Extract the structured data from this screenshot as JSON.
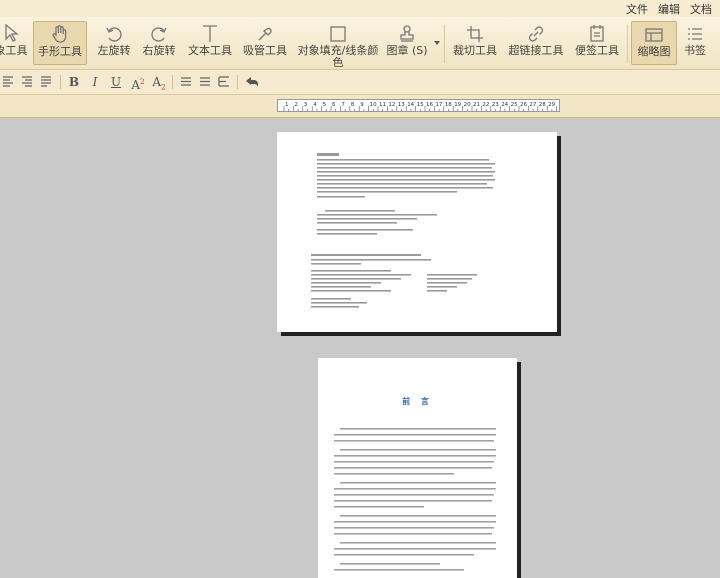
{
  "menu": {
    "items": [
      "文件",
      "编辑",
      "文档"
    ]
  },
  "toolbar": {
    "tools": [
      {
        "label": "象工具",
        "icon": "select-arrow-icon"
      },
      {
        "label": "手形工具",
        "icon": "hand-icon"
      },
      {
        "label": "左旋转",
        "icon": "rotate-left-icon"
      },
      {
        "label": "右旋转",
        "icon": "rotate-right-icon"
      },
      {
        "label": "文本工具",
        "icon": "text-t-icon"
      },
      {
        "label": "吸管工具",
        "icon": "eyedropper-icon"
      },
      {
        "label": "对象填充/线条颜色",
        "icon": "fill-box-icon"
      },
      {
        "label": "图章 (S)",
        "icon": "stamp-icon"
      },
      {
        "label": "裁切工具",
        "icon": "crop-icon"
      },
      {
        "label": "超链接工具",
        "icon": "link-icon"
      },
      {
        "label": "便签工具",
        "icon": "note-icon"
      },
      {
        "label": "缩略图",
        "icon": "thumbnail-icon"
      },
      {
        "label": "书签",
        "icon": "bookmark-list-icon"
      }
    ],
    "active": "手形工具"
  },
  "format_bar": {
    "bold": "B",
    "italic": "I",
    "underline": "U",
    "superscript": "A",
    "superscript_mark": "2",
    "subscript": "A",
    "subscript_mark": "2"
  },
  "ruler": {
    "ticks": [
      "1",
      "2",
      "3",
      "4",
      "5",
      "6",
      "7",
      "8",
      "9",
      "10",
      "11",
      "12",
      "13",
      "14",
      "15",
      "16",
      "17",
      "18",
      "19",
      "20",
      "21",
      "22",
      "23",
      "24",
      "25",
      "26",
      "27",
      "28",
      "29"
    ]
  },
  "pages": {
    "page2_title": "前 言"
  }
}
